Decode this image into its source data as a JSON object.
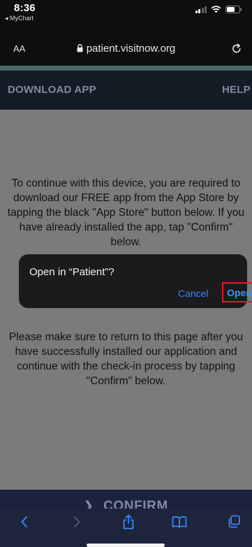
{
  "status_bar": {
    "time": "8:36",
    "back_app": "◂ MyChart"
  },
  "address_bar": {
    "text_size_label": "AA",
    "url": "patient.visitnow.org"
  },
  "site_nav": {
    "download_app": "DOWNLOAD APP",
    "help": "HELP"
  },
  "content": {
    "instructions_1": "To continue with this device, you are required to download our FREE app from the App Store by tapping the black \"App Store\" button below. If you have already installed the app, tap \"Confirm\" below.",
    "instructions_2": "Please make sure to return to this page after you have successfully installed our application and continue with the check-in process by tapping \"Confirm\" below.",
    "confirm_label": "CONFIRM"
  },
  "dialog": {
    "title": "Open in “Patient”?",
    "cancel_label": "Cancel",
    "open_label": "Open",
    "highlight_color": "#e3192d"
  },
  "toolbar": {
    "items": [
      "back-icon",
      "forward-icon",
      "share-icon",
      "bookmarks-icon",
      "tabs-icon"
    ]
  },
  "colors": {
    "link_blue": "#2f89fb",
    "nav_bg": "#161c25",
    "confirm_bg": "#1a2240"
  }
}
